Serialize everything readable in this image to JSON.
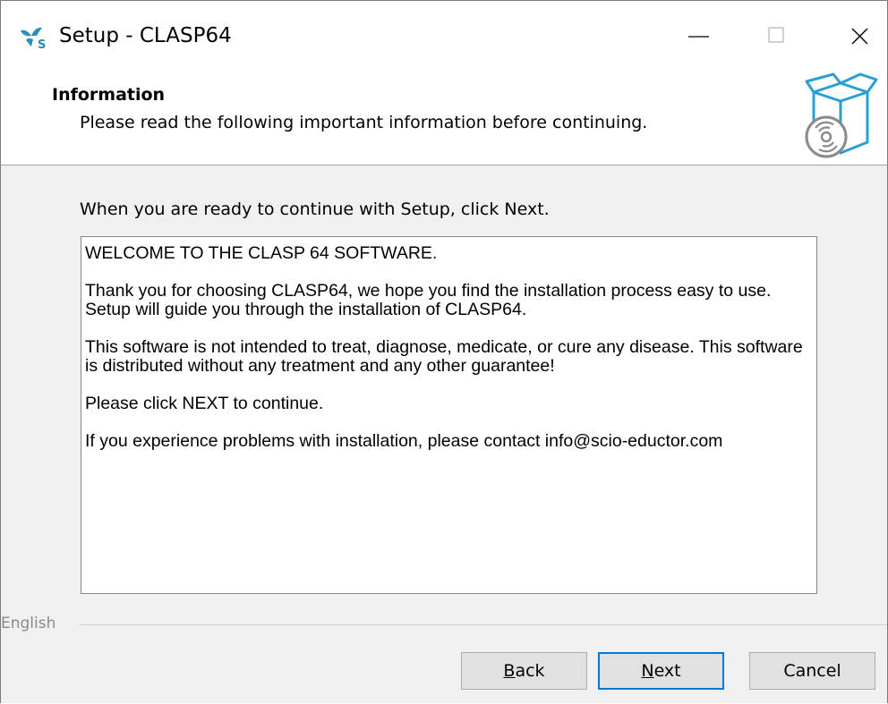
{
  "window": {
    "title": "Setup - CLASP64"
  },
  "titlebar": {
    "minimize_icon": "minimize-icon",
    "maximize_icon": "maximize-icon",
    "close_icon": "close-icon"
  },
  "header": {
    "title": "Information",
    "subtitle": "Please read the following important information before continuing.",
    "icon": "software-box-cd-icon"
  },
  "body": {
    "instruction": "When you are ready to continue with Setup, click Next.",
    "info_paragraphs": [
      "WELCOME TO THE CLASP 64 SOFTWARE.",
      "Thank you for choosing CLASP64, we hope you find the installation process easy to use.\nSetup will guide you through the installation of CLASP64.",
      "This software is not intended to treat, diagnose, medicate, or cure any disease. This software is distributed without any treatment and any other guarantee!",
      "Please click NEXT to continue.",
      "If you experience problems with installation, please contact info@scio-eductor.com"
    ]
  },
  "language": {
    "label": "English"
  },
  "buttons": {
    "back_prefix": "",
    "back_accel": "B",
    "back_rest": "ack",
    "next_prefix": "",
    "next_accel": "N",
    "next_rest": "ext",
    "cancel": "Cancel"
  },
  "colors": {
    "accent": "#0078d7",
    "window_bg": "#f0f0f0",
    "header_bg": "#ffffff",
    "icon_teal": "#2a8fbd"
  }
}
